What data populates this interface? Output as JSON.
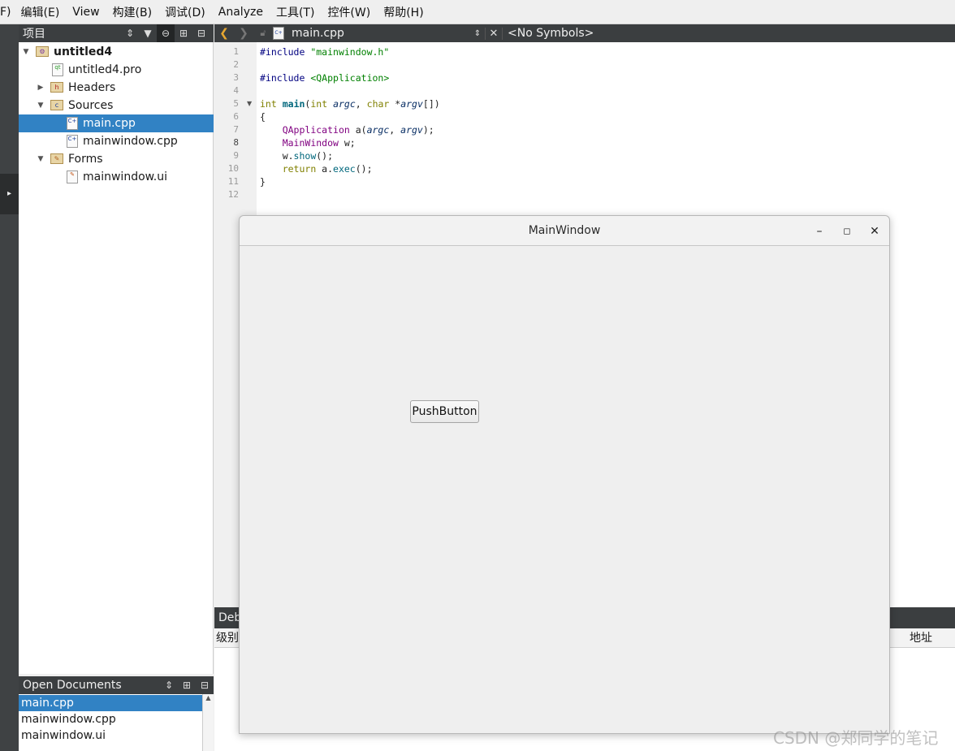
{
  "menu": {
    "items": [
      "F)",
      "编辑(E)",
      "View",
      "构建(B)",
      "调试(D)",
      "Analyze",
      "工具(T)",
      "控件(W)",
      "帮助(H)"
    ]
  },
  "project_panel": {
    "title": "项目",
    "icons": [
      "updown-icon",
      "filter-icon",
      "link-icon",
      "split-icon",
      "close-icon"
    ],
    "tree": [
      {
        "label": "untitled4",
        "kind": "project",
        "expanded": true
      },
      {
        "label": "untitled4.pro",
        "kind": "pro-file"
      },
      {
        "label": "Headers",
        "kind": "folder",
        "expanded": false
      },
      {
        "label": "Sources",
        "kind": "folder",
        "expanded": true
      },
      {
        "label": "main.cpp",
        "kind": "cpp-file",
        "selected": true
      },
      {
        "label": "mainwindow.cpp",
        "kind": "cpp-file"
      },
      {
        "label": "Forms",
        "kind": "folder",
        "expanded": true
      },
      {
        "label": "mainwindow.ui",
        "kind": "ui-file"
      }
    ]
  },
  "open_documents": {
    "title": "Open Documents",
    "items": [
      "main.cpp",
      "mainwindow.cpp",
      "mainwindow.ui"
    ],
    "selected": "main.cpp"
  },
  "editor": {
    "file_name": "main.cpp",
    "symbols": "<No Symbols>",
    "current_line": 8,
    "line_numbers": [
      "1",
      "2",
      "3",
      "4",
      "5",
      "6",
      "7",
      "8",
      "9",
      "10",
      "11",
      "12"
    ],
    "lines": [
      "#include \"mainwindow.h\"",
      "",
      "#include <QApplication>",
      "",
      "int main(int argc, char *argv[])",
      "{",
      "    QApplication a(argc, argv);",
      "    MainWindow w;",
      "    w.show();",
      "    return a.exec();",
      "}",
      ""
    ]
  },
  "debug_panel": {
    "title": "Deb",
    "columns": [
      "级别",
      "地址"
    ]
  },
  "app_window": {
    "title": "MainWindow",
    "button_label": "PushButton",
    "controls": [
      "minimize-icon",
      "maximize-icon",
      "close-icon"
    ]
  },
  "watermark": "CSDN @郑同学的笔记"
}
